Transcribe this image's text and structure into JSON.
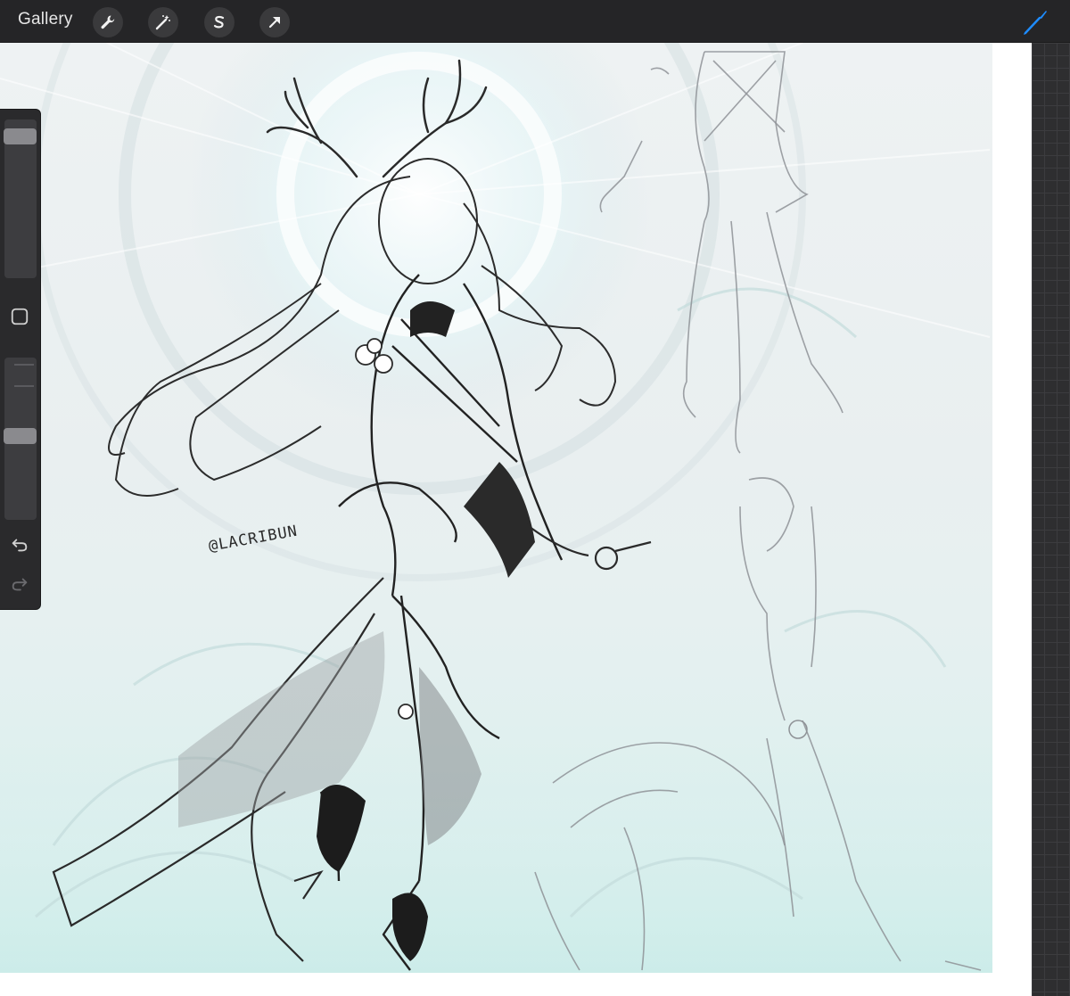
{
  "app": {
    "gallery_label": "Gallery",
    "accent_color": "#1e8cff"
  },
  "toolbar": {
    "tools": [
      {
        "name": "actions-wrench-icon"
      },
      {
        "name": "adjustments-magic-wand-icon"
      },
      {
        "name": "selection-s-icon"
      },
      {
        "name": "transform-arrow-icon"
      }
    ],
    "right_tool": "brush-icon"
  },
  "canvas": {
    "signature": "@LACRIBUN"
  },
  "sidebar": {
    "brush_size_level": 0.06,
    "opacity_level": 0.48,
    "icons": [
      "modify-square-icon",
      "undo-icon",
      "redo-icon"
    ]
  }
}
